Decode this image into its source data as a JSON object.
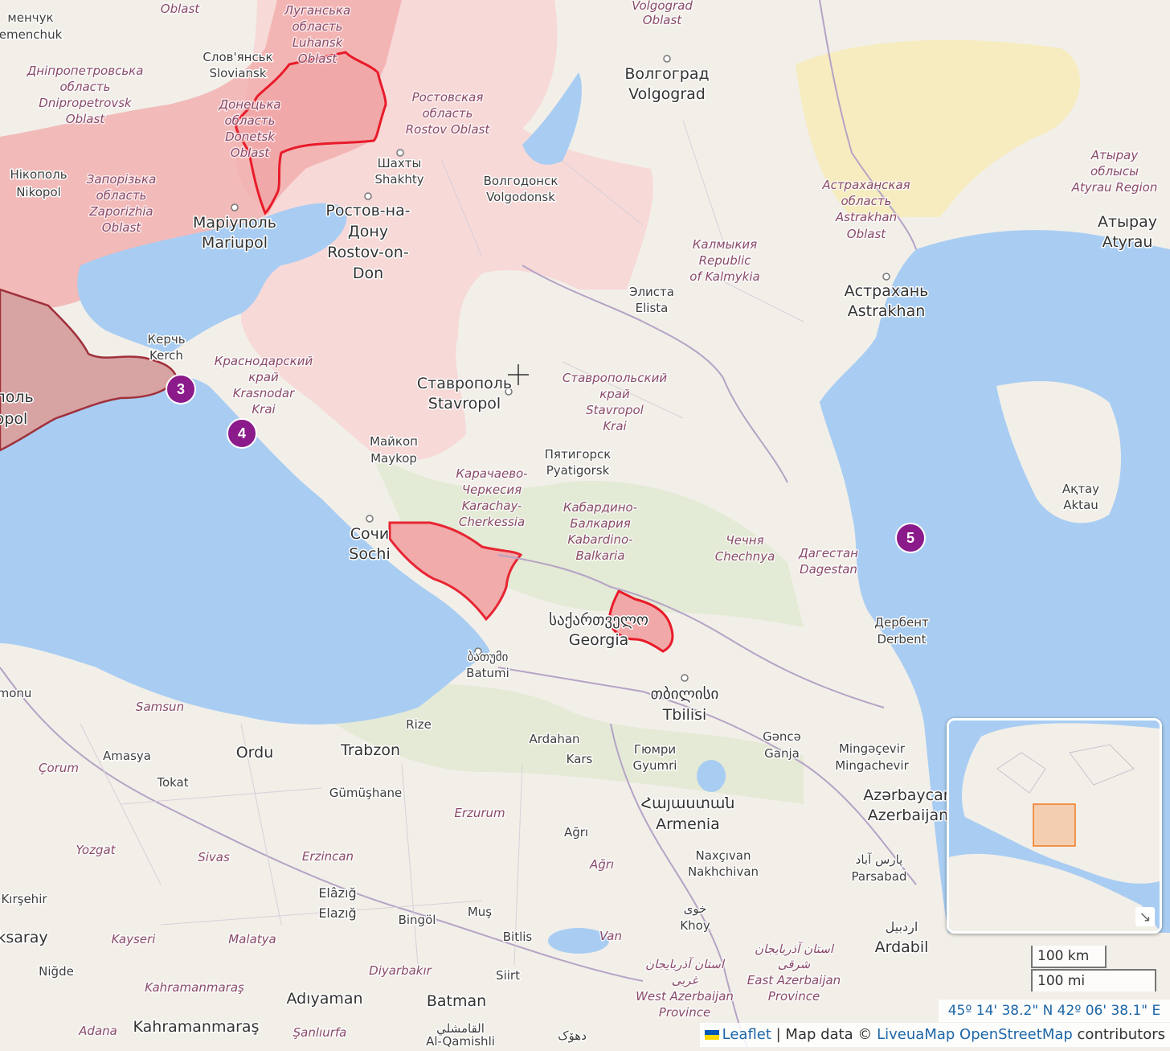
{
  "labels": {
    "cities": [
      {
        "text": "Волгоград"
      },
      {
        "text": "Volgograd"
      },
      {
        "text": "Шахты"
      },
      {
        "text": "Shakhty"
      },
      {
        "text": "Волгодонск"
      },
      {
        "text": "Volgodonsk"
      },
      {
        "text": "Ростов-на-"
      },
      {
        "text": "Дону"
      },
      {
        "text": "Rostov-on-"
      },
      {
        "text": "Don"
      },
      {
        "text": "Маріуполь"
      },
      {
        "text": "Mariupol"
      },
      {
        "text": "Слов'янськ"
      },
      {
        "text": "Sloviansk"
      },
      {
        "text": "Нікополь"
      },
      {
        "text": "Nikopol"
      },
      {
        "text": "Керчь"
      },
      {
        "text": "Kerch"
      },
      {
        "text": "Ставрополь"
      },
      {
        "text": "Stavropol"
      },
      {
        "text": "Майкоп"
      },
      {
        "text": "Maykop"
      },
      {
        "text": "Пятигорск"
      },
      {
        "text": "Pyatigorsk"
      },
      {
        "text": "Сочи"
      },
      {
        "text": "Sochi"
      },
      {
        "text": "Элиста"
      },
      {
        "text": "Elista"
      },
      {
        "text": "Астрахань"
      },
      {
        "text": "Astrakhan"
      },
      {
        "text": "Атырау"
      },
      {
        "text": "Atyrau"
      },
      {
        "text": "Ақтау"
      },
      {
        "text": "Aktau"
      },
      {
        "text": "Дербент"
      },
      {
        "text": "Derbent"
      },
      {
        "text": "ბათუმი"
      },
      {
        "text": "Batumi"
      },
      {
        "text": "საქართველო"
      },
      {
        "text": "Georgia"
      },
      {
        "text": "თბილისი"
      },
      {
        "text": "Tbilisi"
      },
      {
        "text": "Gəncə"
      },
      {
        "text": "Ganja"
      },
      {
        "text": "Mingəçevir"
      },
      {
        "text": "Mingachevir"
      },
      {
        "text": "Azərbaycan"
      },
      {
        "text": "Azerbaijan"
      },
      {
        "text": "Гюмри"
      },
      {
        "text": "Gyumri"
      },
      {
        "text": "Հայաստան"
      },
      {
        "text": "Armenia"
      },
      {
        "text": "Naxçıvan"
      },
      {
        "text": "Nakhchivan"
      },
      {
        "text": "پارس آباد"
      },
      {
        "text": "Parsabad"
      },
      {
        "text": "اردبیل"
      },
      {
        "text": "Ardabil"
      },
      {
        "text": "خوی"
      },
      {
        "text": "Khoy"
      },
      {
        "text": "Rize"
      },
      {
        "text": "Trabzon"
      },
      {
        "text": "Ordu"
      },
      {
        "text": "Ardahan"
      },
      {
        "text": "Kars"
      },
      {
        "text": "Amasya"
      },
      {
        "text": "Tokat"
      },
      {
        "text": "Gümüşhane"
      },
      {
        "text": "Ağrı"
      },
      {
        "text": "Elâzığ"
      },
      {
        "text": "Elazığ"
      },
      {
        "text": "Bingöl"
      },
      {
        "text": "Muş"
      },
      {
        "text": "Bitlis"
      },
      {
        "text": "Siirt"
      },
      {
        "text": "Batman"
      },
      {
        "text": "Adıyaman"
      },
      {
        "text": "Kahramanmaraş"
      },
      {
        "text": "Niğde"
      },
      {
        "text": "Kırşehir"
      },
      {
        "text": "ksaray"
      },
      {
        "text": "القامشلي"
      },
      {
        "text": "Al-Qamishli"
      },
      {
        "text": "دهۆک"
      },
      {
        "text": "менчук"
      },
      {
        "text": "emenchuk"
      },
      {
        "text": "поль"
      },
      {
        "text": "opol"
      },
      {
        "text": "monu"
      }
    ],
    "regions": [
      {
        "text": "Луганська"
      },
      {
        "text": "область"
      },
      {
        "text": "Luhansk"
      },
      {
        "text": "Oblast"
      },
      {
        "text": "Дніпропетровська"
      },
      {
        "text": "область"
      },
      {
        "text": "Dnipropetrovsk"
      },
      {
        "text": "Oblast"
      },
      {
        "text": "Донецька"
      },
      {
        "text": "область"
      },
      {
        "text": "Donetsk"
      },
      {
        "text": "Oblast"
      },
      {
        "text": "Запорізька"
      },
      {
        "text": "область"
      },
      {
        "text": "Zaporizhia"
      },
      {
        "text": "Oblast"
      },
      {
        "text": "Ростовская"
      },
      {
        "text": "область"
      },
      {
        "text": "Rostov Oblast"
      },
      {
        "text": "Краснодарский"
      },
      {
        "text": "край"
      },
      {
        "text": "Krasnodar"
      },
      {
        "text": "Krai"
      },
      {
        "text": "Ставропольский"
      },
      {
        "text": "край"
      },
      {
        "text": "Stavropol"
      },
      {
        "text": "Krai"
      },
      {
        "text": "Калмыкия"
      },
      {
        "text": "Republic"
      },
      {
        "text": "of Kalmykia"
      },
      {
        "text": "Астраханская"
      },
      {
        "text": "область"
      },
      {
        "text": "Astrakhan"
      },
      {
        "text": "Oblast"
      },
      {
        "text": "Атырау"
      },
      {
        "text": "облысы"
      },
      {
        "text": "Atyrau Region"
      },
      {
        "text": "Карачаево-"
      },
      {
        "text": "Черкесия"
      },
      {
        "text": "Karachay-"
      },
      {
        "text": "Cherkessia"
      },
      {
        "text": "Кабардино-"
      },
      {
        "text": "Балкария"
      },
      {
        "text": "Kabardino-"
      },
      {
        "text": "Balkaria"
      },
      {
        "text": "Чечня"
      },
      {
        "text": "Chechnya"
      },
      {
        "text": "Дагестан"
      },
      {
        "text": "Dagestan"
      },
      {
        "text": "Volgograd"
      },
      {
        "text": "Oblast"
      },
      {
        "text": "Oblast"
      },
      {
        "text": "Samsun"
      },
      {
        "text": "Çorum"
      },
      {
        "text": "Yozgat"
      },
      {
        "text": "Sivas"
      },
      {
        "text": "Erzincan"
      },
      {
        "text": "Erzurum"
      },
      {
        "text": "Ağrı"
      },
      {
        "text": "Van"
      },
      {
        "text": "Kayseri"
      },
      {
        "text": "Malatya"
      },
      {
        "text": "Diyarbakır"
      },
      {
        "text": "Kahramanmaraş"
      },
      {
        "text": "Adana"
      },
      {
        "text": "Şanlıurfa"
      },
      {
        "text": "استان آذربایجان"
      },
      {
        "text": "شرقی"
      },
      {
        "text": "East Azerbaijan"
      },
      {
        "text": "Province"
      },
      {
        "text": "استان آذربایجان"
      },
      {
        "text": "غربی"
      },
      {
        "text": "West Azerbaijan"
      },
      {
        "text": "Province"
      }
    ]
  },
  "markers": [
    {
      "label": "3"
    },
    {
      "label": "4"
    },
    {
      "label": "5"
    }
  ],
  "scale": {
    "km": "100 km",
    "mi": "100 mi"
  },
  "coordinates": "45º 14' 38.2\" N 42º 06' 38.1\" E",
  "attribution": {
    "leaflet": "Leaflet",
    "sep": " | Map data © ",
    "liveuamap": "LiveuaMap",
    "osm": "OpenStreetMap",
    "suffix": " contributors"
  },
  "colors": {
    "sea": "#a9cdf2",
    "land": "#f2efe9",
    "occupied": "#f1a8a8",
    "occupied_border": "#e81b2a",
    "russia_tint": "#f7d6d6"
  },
  "icons": [
    "crosshair-icon",
    "minimap-toggle-icon",
    "ukraine-flag-icon"
  ]
}
